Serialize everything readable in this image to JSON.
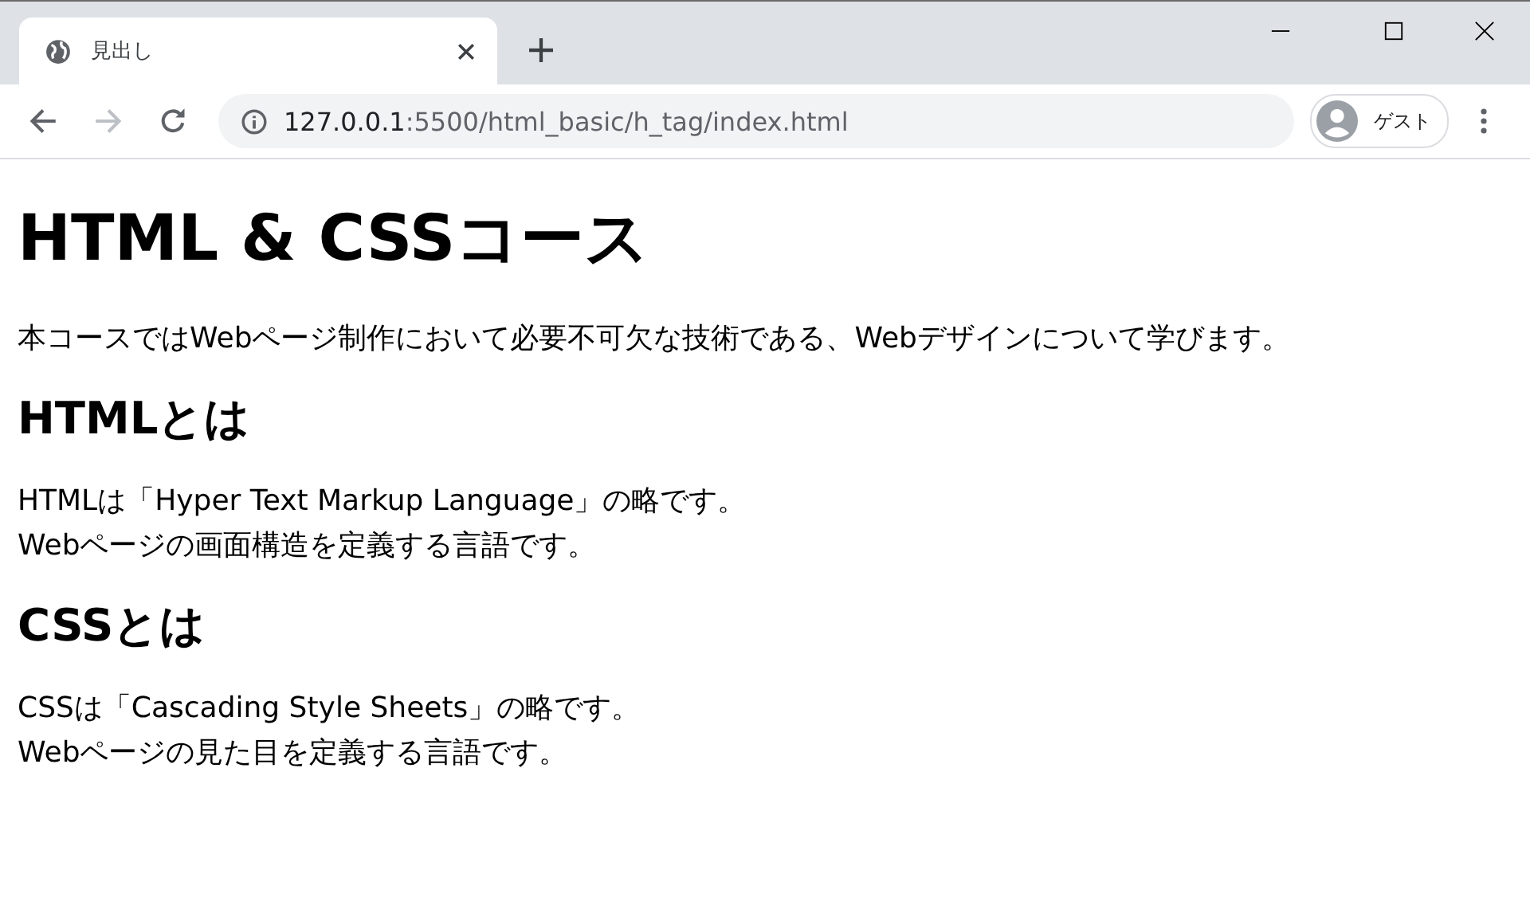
{
  "tab": {
    "title": "見出し"
  },
  "navigation": [
    {
      "kind": "back",
      "disabled": false
    },
    {
      "kind": "forward",
      "disabled": true
    },
    {
      "kind": "reload",
      "disabled": false
    }
  ],
  "address": {
    "host": "127.0.0.1",
    "path": ":5500/html_basic/h_tag/index.html"
  },
  "profile": {
    "label": "ゲスト"
  },
  "page": {
    "title": "HTML & CSSコース",
    "intro": "本コースではWebページ制作において必要不可欠な技術である、Webデザインについて学びます。",
    "sections": [
      {
        "heading": "HTMLとは",
        "lines": [
          "HTMLは「Hyper Text Markup Language」の略です。",
          "Webページの画面構造を定義する言語です。"
        ]
      },
      {
        "heading": "CSSとは",
        "lines": [
          "CSSは「Cascading Style Sheets」の略です。",
          "Webページの見た目を定義する言語です。"
        ]
      }
    ]
  }
}
